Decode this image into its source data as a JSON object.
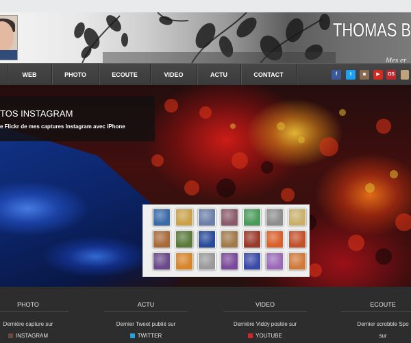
{
  "header": {
    "title": "THOMAS B",
    "tagline": "Mes er"
  },
  "nav": {
    "items": [
      "WEB",
      "PHOTO",
      "ECOUTE",
      "VIDEO",
      "ACTU",
      "CONTACT"
    ]
  },
  "social": [
    {
      "icon": "facebook-icon",
      "label": "f",
      "color": "#3b5998"
    },
    {
      "icon": "twitter-icon",
      "label": "t",
      "color": "#1da1f2"
    },
    {
      "icon": "instagram-icon",
      "label": "◙",
      "color": "#8a6a4f"
    },
    {
      "icon": "youtube-icon",
      "label": "▶",
      "color": "#d52a21"
    },
    {
      "icon": "os-icon",
      "label": "OS",
      "color": "#c0272d"
    },
    {
      "icon": "profile-icon",
      "label": "",
      "color": "#bfa37a"
    }
  ],
  "hero": {
    "caption_title": "TOS INSTAGRAM",
    "caption_text": "e Flickr de mes captures Instagram avec iPhone"
  },
  "thumbnails": [
    [
      "#3a6aa8",
      "#c9a14a",
      "#6b7fa8",
      "#8a5a6a",
      "#4a9a5a",
      "#8e8e8e",
      "#c8b06a"
    ],
    [
      "#a86a3a",
      "#5a7a3a",
      "#2a4a9a",
      "#a07a4a",
      "#9a3a2a",
      "#d9602a",
      "#c2502a"
    ],
    [
      "#6a4a8a",
      "#d8842a",
      "#9a9a9a",
      "#7a4a9a",
      "#3a4aa8",
      "#9a6ab8",
      "#d07a3a"
    ]
  ],
  "footer": {
    "columns": [
      {
        "title": "PHOTO",
        "text": "Dernière capture sur",
        "link": "INSTAGRAM",
        "icon": "instagram-icon",
        "icon_color": "#6a4a3a"
      },
      {
        "title": "ACTU",
        "text": "Dernier Tweet publié sur",
        "link": "TWITTER",
        "icon": "twitter-icon",
        "icon_color": "#2aa0e0"
      },
      {
        "title": "VIDEO",
        "text": "Dernière Viddy postée sur",
        "link": "YOUTUBE",
        "icon": "youtube-icon",
        "icon_color": "#d0262a"
      },
      {
        "title": "ECOUTE",
        "text": "Dernier scrobble Spo",
        "link": "sur",
        "icon": "",
        "icon_color": ""
      }
    ]
  }
}
